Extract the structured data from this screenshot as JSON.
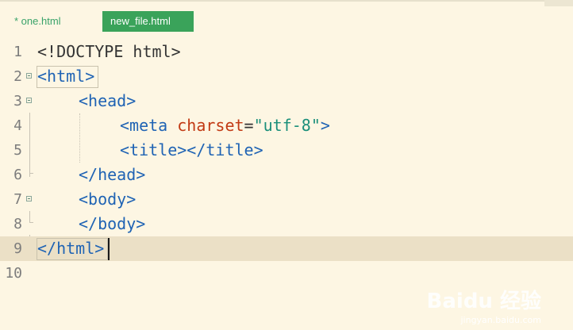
{
  "tabs": [
    {
      "label": "* one.html",
      "active": false
    },
    {
      "label": "new_file.html",
      "active": true
    }
  ],
  "editor": {
    "current_line": 9,
    "lines": [
      {
        "num": "1"
      },
      {
        "num": "2"
      },
      {
        "num": "3"
      },
      {
        "num": "4"
      },
      {
        "num": "5"
      },
      {
        "num": "6"
      },
      {
        "num": "7"
      },
      {
        "num": "8"
      },
      {
        "num": "9"
      },
      {
        "num": "10"
      }
    ],
    "tokens": {
      "l1": "<!DOCTYPE html>",
      "l2": "<html>",
      "l3": "<head>",
      "l4_tag": "<meta ",
      "l4_attr": "charset",
      "l4_eq": "=",
      "l4_str": "\"utf-8\"",
      "l4_end": ">",
      "l5_open": "<title>",
      "l5_close": "</title>",
      "l6": "</head>",
      "l7": "<body>",
      "l8": "</body>",
      "l9": "</html>"
    }
  },
  "watermark": {
    "brand": "Baidu 经验",
    "url": "jingyan.baidu.com"
  },
  "colors": {
    "tab_active_bg": "#3aa35a",
    "background": "#fdf6e3",
    "current_line_bg": "#ebe0c6"
  }
}
